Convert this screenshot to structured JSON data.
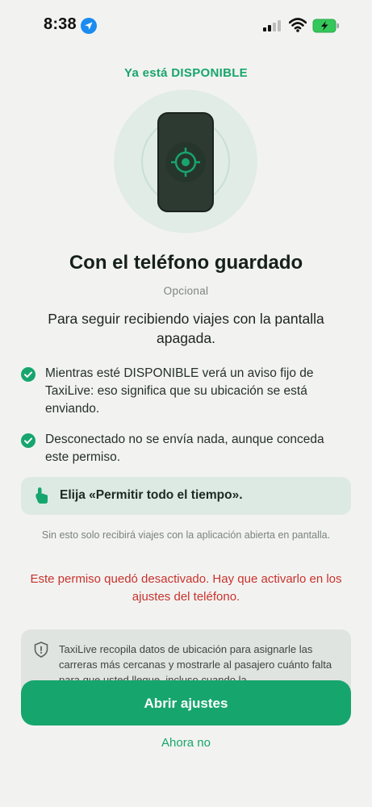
{
  "status_bar": {
    "time": "8:38"
  },
  "header": {
    "eyebrow": "Ya está DISPONIBLE"
  },
  "main": {
    "title": "Con el teléfono guardado",
    "optional": "Opcional",
    "subtitle": "Para seguir recibiendo viajes con la pantalla apagada.",
    "bullets": [
      {
        "text": "Mientras esté DISPONIBLE verá un aviso fijo de TaxiLive: eso significa que su ubicación se está enviando."
      },
      {
        "text": "Desconectado no se envía nada, aunque conceda este permiso."
      }
    ],
    "tip": "Elija «Permitir todo el tiempo».",
    "note": "Sin esto solo recibirá viajes con la aplicación abierta en pantalla.",
    "warning": "Este permiso quedó desactivado. Hay que activarlo en los ajustes del teléfono.",
    "privacy": "TaxiLive recopila datos de ubicación para asignarle las carreras más cercanas y mostrarle al pasajero cuánto falta para que usted llegue, incluso cuando la"
  },
  "actions": {
    "primary": "Abrir ajustes",
    "secondary": "Ahora no"
  },
  "colors": {
    "accent": "#17a56e",
    "warning": "#c8322d",
    "background": "#f2f3f1"
  },
  "icons": [
    "location-arrow-icon",
    "signal-icon",
    "wifi-icon",
    "battery-charging-icon",
    "phone-locate-icon",
    "check-circle-icon",
    "hand-pointer-icon",
    "shield-icon"
  ]
}
